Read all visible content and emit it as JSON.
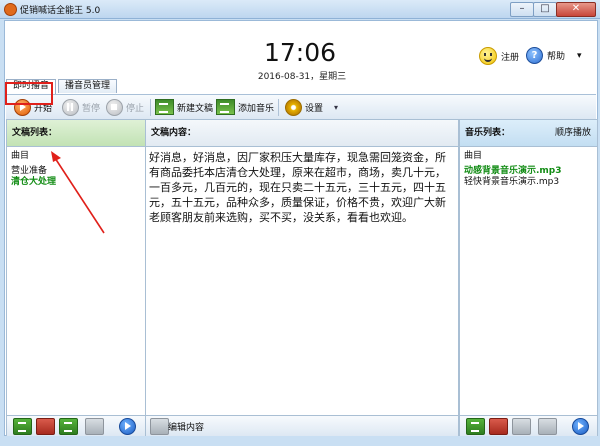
{
  "window": {
    "title": "促销喊话全能王 5.0",
    "min": "–",
    "max": "□",
    "close": "✕"
  },
  "clock": {
    "time": "17:06",
    "date": "2016-08-31，星期三"
  },
  "top_actions": {
    "register": "注册",
    "help": "帮助",
    "menu": "▾"
  },
  "tabs": [
    {
      "label": "即时播音"
    },
    {
      "label": "播音员管理"
    }
  ],
  "toolbar": {
    "start": "开始",
    "pause": "暂停",
    "stop": "停止",
    "new_doc": "新建文稿",
    "add_music": "添加音乐",
    "settings": "设置",
    "settings_menu": "▾"
  },
  "doc_list": {
    "header": "文稿列表：",
    "col": "曲目",
    "items": [
      "营业准备",
      "清仓大处理"
    ]
  },
  "doc_content": {
    "header": "文稿内容：",
    "text": "好消息，好消息，因厂家积压大量库存，现急需回笼资金，所有商品委托本店清仓大处理，原来在超市，商场，卖几十元，一百多元，几百元的，现在只卖二十五元，三十五元，四十五元，五十五元，品种众多，质量保证，价格不贵，欢迎广大新老顾客朋友前来选购，买不买，没关系，看看也欢迎。"
  },
  "music_list": {
    "header": "音乐列表：",
    "order": "顺序播放",
    "col": "曲目",
    "items": [
      "动感背景音乐演示.mp3",
      "轻快背景音乐演示.mp3"
    ]
  },
  "bottom": {
    "edit": "编辑内容"
  },
  "colors": {
    "accent": "#e0201a",
    "green_text": "#128c14",
    "header_green": "#c2e2b4"
  }
}
